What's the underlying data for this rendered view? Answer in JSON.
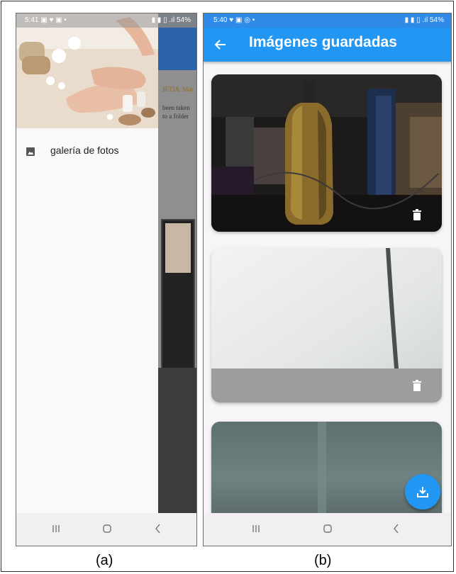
{
  "captions": {
    "a": "(a)",
    "b": "(b)"
  },
  "phone_a": {
    "status": {
      "time": "5:41",
      "left_icons": "▣ ♥ ▣ •",
      "right_icons": "▮ ▮ ▯ .ıl",
      "battery": "54%"
    },
    "background_doc": {
      "title_fragment": "JETIA, Mar",
      "line1": "been taken",
      "line2": "to a folder"
    },
    "drawer": {
      "items": [
        {
          "label": "galería de fotos",
          "icon": "image-icon"
        }
      ]
    }
  },
  "phone_b": {
    "status": {
      "time": "5:40",
      "left_icons": "♥ ▣ ◎ •",
      "right_icons": "▮ ▮ ▯ .ıl",
      "battery": "54%"
    },
    "app_bar": {
      "title": "Imágenes guardadas",
      "back_icon": "arrow-back-icon"
    },
    "cards": [
      {
        "description": "dark scene with golden bottle",
        "action_icon": "delete-icon"
      },
      {
        "description": "white mesh fabric",
        "action_icon": "delete-icon"
      },
      {
        "description": "grey fabric",
        "action_icon": null
      }
    ],
    "fab": {
      "icon": "download-icon"
    }
  },
  "colors": {
    "primary": "#2196f3",
    "drawer": "#fbf8fa",
    "navbar": "#f1eff1"
  }
}
